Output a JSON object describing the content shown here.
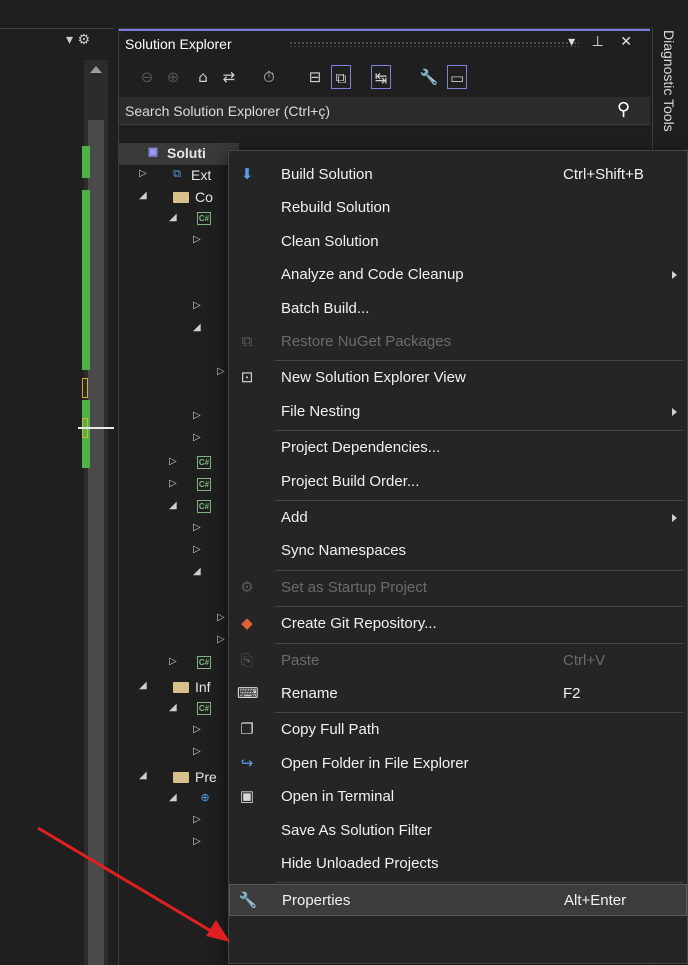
{
  "left_panel": {
    "tools": "▾ ⚙"
  },
  "solution_explorer": {
    "title": "Solution Explorer",
    "title_tools": "▾ ⊥ ✕",
    "search_placeholder": "Search Solution Explorer (Ctrl+ç)",
    "search_icon_glyph": "⚲",
    "toolbar": [
      {
        "name": "back-icon",
        "glyph": "⊖",
        "dim": true
      },
      {
        "name": "forward-icon",
        "glyph": "⊕",
        "dim": true
      },
      {
        "name": "home-icon",
        "glyph": "⌂"
      },
      {
        "name": "switch-views-icon",
        "glyph": "⇄"
      },
      {
        "name": "history-icon",
        "glyph": "⏱"
      },
      {
        "name": "collapse-all-icon",
        "glyph": "⊟"
      },
      {
        "name": "show-all-files-icon",
        "glyph": "⧉",
        "boxed": true
      },
      {
        "name": "sync-icon",
        "glyph": "↹",
        "boxed": true
      },
      {
        "name": "properties-icon",
        "glyph": "🔧"
      },
      {
        "name": "preview-icon",
        "glyph": "▭",
        "boxed": true
      }
    ],
    "tree": [
      {
        "label": "Soluti",
        "selected": true,
        "icon": "sln"
      },
      {
        "label": "Ext",
        "icon": "ext"
      },
      {
        "label": "Co",
        "icon": "folder"
      },
      {
        "label": "",
        "icon": "cs"
      },
      {
        "label": "",
        "icon": ""
      },
      {
        "label": "",
        "icon": ""
      },
      {
        "label": "",
        "icon": ""
      },
      {
        "label": "",
        "icon": ""
      },
      {
        "label": "",
        "icon": ""
      },
      {
        "label": "",
        "icon": ""
      },
      {
        "label": "",
        "icon": "cs"
      },
      {
        "label": "",
        "icon": "cs"
      },
      {
        "label": "",
        "icon": "cs"
      },
      {
        "label": "",
        "icon": ""
      },
      {
        "label": "",
        "icon": ""
      },
      {
        "label": "",
        "icon": ""
      },
      {
        "label": "",
        "icon": ""
      },
      {
        "label": "",
        "icon": ""
      },
      {
        "label": "",
        "icon": "cs"
      },
      {
        "label": "Inf",
        "icon": "folder"
      },
      {
        "label": "",
        "icon": "cs"
      },
      {
        "label": "",
        "icon": ""
      },
      {
        "label": "",
        "icon": ""
      },
      {
        "label": "Pre",
        "icon": "folder"
      },
      {
        "label": "",
        "icon": "web"
      },
      {
        "label": "",
        "icon": ""
      },
      {
        "label": "",
        "icon": ""
      }
    ]
  },
  "diagnostic_tab": {
    "label": "Diagnostic Tools"
  },
  "context_menu": {
    "items": [
      {
        "name": "build-solution",
        "label": "Build Solution",
        "shortcut": "Ctrl+Shift+B",
        "icon": "build-icon",
        "glyph": "⬇"
      },
      {
        "name": "rebuild-solution",
        "label": "Rebuild Solution"
      },
      {
        "name": "clean-solution",
        "label": "Clean Solution"
      },
      {
        "name": "analyze-code-cleanup",
        "label": "Analyze and Code Cleanup",
        "submenu": true
      },
      {
        "name": "batch-build",
        "label": "Batch Build..."
      },
      {
        "name": "restore-nuget",
        "label": "Restore NuGet Packages",
        "disabled": true,
        "icon": "nuget-icon",
        "glyph": "⧉"
      },
      {
        "sep": true
      },
      {
        "name": "new-solution-explorer-view",
        "label": "New Solution Explorer View",
        "icon": "new-view-icon",
        "glyph": "⊡"
      },
      {
        "name": "file-nesting",
        "label": "File Nesting",
        "submenu": true
      },
      {
        "sep": true
      },
      {
        "name": "project-dependencies",
        "label": "Project Dependencies..."
      },
      {
        "name": "project-build-order",
        "label": "Project Build Order..."
      },
      {
        "sep": true
      },
      {
        "name": "add",
        "label": "Add",
        "submenu": true
      },
      {
        "name": "sync-namespaces",
        "label": "Sync Namespaces"
      },
      {
        "sep": true
      },
      {
        "name": "set-startup-project",
        "label": "Set as Startup Project",
        "disabled": true,
        "icon": "gear-icon",
        "glyph": "⚙"
      },
      {
        "sep": true
      },
      {
        "name": "create-git-repository",
        "label": "Create Git Repository...",
        "icon": "git-icon",
        "glyph": "◆"
      },
      {
        "sep": true
      },
      {
        "name": "paste",
        "label": "Paste",
        "shortcut": "Ctrl+V",
        "disabled": true,
        "icon": "paste-icon",
        "glyph": "⎘"
      },
      {
        "name": "rename",
        "label": "Rename",
        "shortcut": "F2",
        "icon": "rename-icon",
        "glyph": "⌨"
      },
      {
        "sep": true
      },
      {
        "name": "copy-full-path",
        "label": "Copy Full Path",
        "icon": "copy-icon",
        "glyph": "❐"
      },
      {
        "name": "open-folder-file-explorer",
        "label": "Open Folder in File Explorer",
        "icon": "open-folder-icon",
        "glyph": "↪"
      },
      {
        "name": "open-in-terminal",
        "label": "Open in Terminal",
        "icon": "terminal-icon",
        "glyph": "▣"
      },
      {
        "name": "save-as-solution-filter",
        "label": "Save As Solution Filter"
      },
      {
        "name": "hide-unloaded-projects",
        "label": "Hide Unloaded Projects"
      },
      {
        "sep": true
      },
      {
        "name": "properties",
        "label": "Properties",
        "shortcut": "Alt+Enter",
        "icon": "wrench-icon",
        "glyph": "🔧",
        "hover": true
      }
    ]
  },
  "colors": {
    "accent": "#7f7fe0",
    "menu_bg": "#252526",
    "arrow": "#e02020",
    "scroll_green": "#4db248"
  }
}
